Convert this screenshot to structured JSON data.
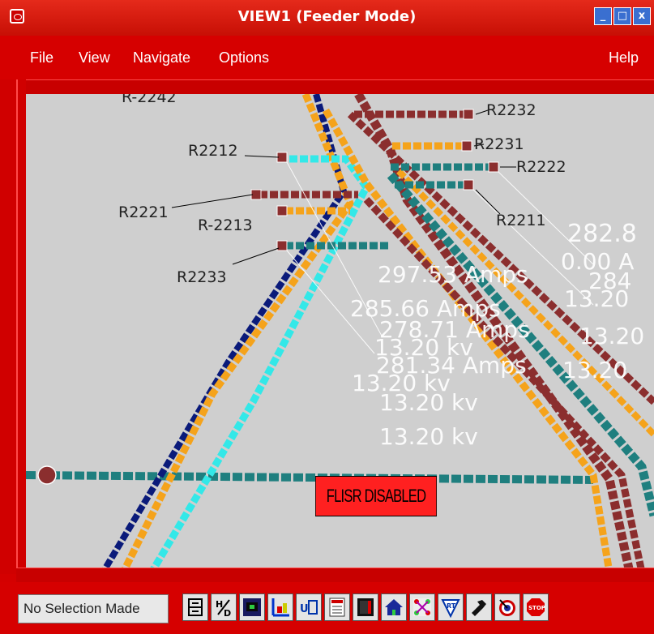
{
  "window": {
    "title": "VIEW1 (Feeder Mode)"
  },
  "menu": {
    "file": "File",
    "view": "View",
    "navigate": "Navigate",
    "options": "Options",
    "help": "Help"
  },
  "feeders": {
    "labels": [
      "R-2242",
      "R2232",
      "R2231",
      "R2222",
      "R2212",
      "R2221",
      "R-2213",
      "R2211",
      "R2233"
    ],
    "readouts": [
      "282.8",
      "0.00 A",
      "297.53 Amps",
      "284",
      "13.20",
      "285.66 Amps",
      "278.71 Amps",
      "13.20 kv",
      "281.34 Amps",
      "13.20 kv",
      "13.20",
      "13.20",
      "13.20 kv",
      "13.20 kv"
    ]
  },
  "alarm": {
    "text": "FLISR DISABLED"
  },
  "status": {
    "text": "No Selection Made"
  },
  "colors": {
    "frame": "#d40000",
    "canvas": "#cfcfcf",
    "navy": "#0a1a7a",
    "orange": "#f5a31b",
    "brown": "#8b2e2e",
    "teal": "#1f7f7f",
    "cyan": "#33e8e8"
  },
  "toolbar": [
    "layers-icon",
    "h-over-d-icon",
    "display-icon",
    "chart-icon",
    "ub-icon",
    "report-icon",
    "panel-icon",
    "house-icon",
    "network-icon",
    "rt-badge-icon",
    "wrench-icon",
    "target-icon",
    "stop-icon"
  ]
}
